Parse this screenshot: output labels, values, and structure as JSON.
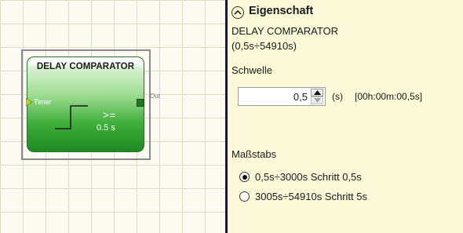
{
  "block": {
    "title": "DELAY COMPARATOR",
    "input_label": "Timer",
    "operator": ">=",
    "delay": "0.5 s",
    "output_label": "Out"
  },
  "panel": {
    "title": "Eigenschaft",
    "component_name": "DELAY COMPARATOR",
    "component_range": "(0,5s÷54910s)",
    "threshold_label": "Schwelle",
    "threshold_value": "0,5",
    "unit": "(s)",
    "time_display": "[00h:00m:00,5s]",
    "scale_label": "Maßstabs",
    "scale_options": [
      {
        "label": "0,5s÷3000s Schritt 0,5s",
        "selected": true
      },
      {
        "label": "3005s÷54910s Schritt 5s",
        "selected": false
      }
    ]
  },
  "colors": {
    "block_green": "#3fae3a",
    "panel_bg": "#fcf9d8",
    "divider": "#16164f",
    "input_pin": "#b6d92a"
  },
  "icons": {
    "collapse": "chevron-up-circle-icon",
    "spin_up": "triangle-up-icon",
    "spin_down": "triangle-down-icon"
  }
}
